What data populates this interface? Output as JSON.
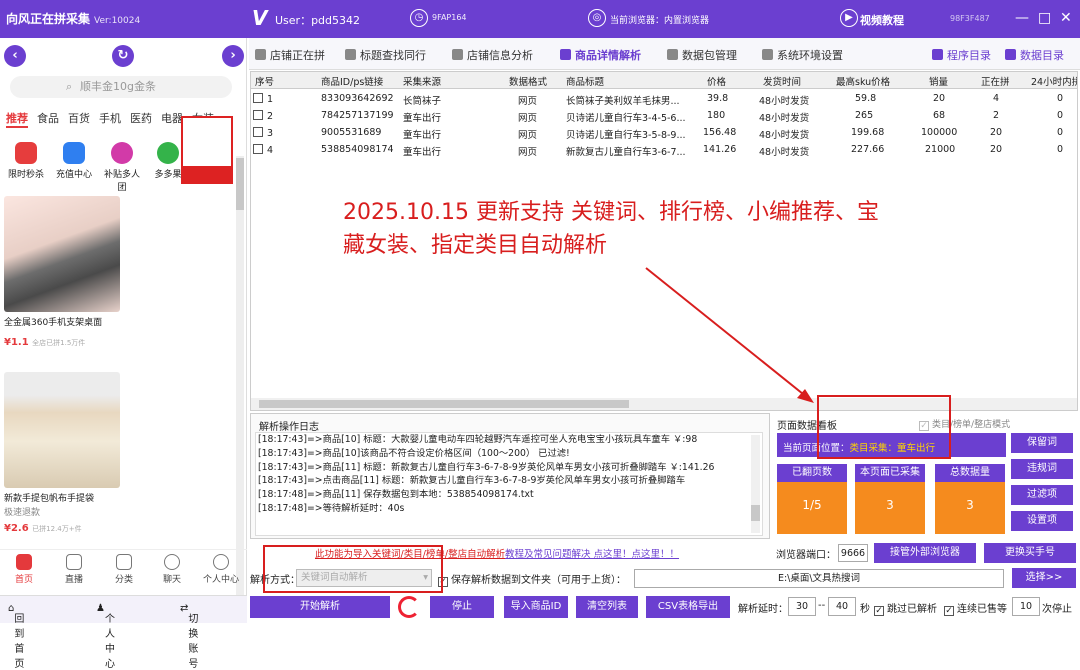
{
  "topbar": {
    "app_title": "向风正在拼采集",
    "version": "Ver:10024",
    "user": "User：pdd5342",
    "device": "9FAP164",
    "browser": "当前浏览器：内置浏览器",
    "tutorial": "视频教程",
    "code": "98F3F487",
    "min": "—",
    "max": "□",
    "close": "✕"
  },
  "left": {
    "back": "‹",
    "refresh": "↻",
    "forward": "›",
    "search_placeholder": "顺丰金10g金条",
    "cats": [
      "推荐",
      "食品",
      "百货",
      "手机",
      "医药",
      "电器",
      "女装"
    ],
    "shortcuts": [
      "限时秒杀",
      "充值中心",
      "补贴多人团",
      "多多果"
    ],
    "products": [
      {
        "title": "全金属360手机支架桌面",
        "price": "¥1.1",
        "sold": "全店已拼1.5万件"
      },
      {
        "title": "新款手提包帆布手提袋",
        "subtitle": "极速退款",
        "price": "¥2.6",
        "sold": "已拼12.4万+件"
      }
    ],
    "bottom_nav": [
      "首页",
      "直播",
      "分类",
      "聊天",
      "个人中心"
    ],
    "footer": {
      "home": "回到首页",
      "personal": "个人中心",
      "switch": "切换账号"
    }
  },
  "tabs": {
    "shops": "店铺正在拼",
    "keyword": "标题查找同行",
    "shop_analysis": "店铺信息分析",
    "detail": "商品详情解析",
    "packages": "数据包管理",
    "env": "系统环境设置",
    "prog_dir": "程序目录",
    "data_dir": "数据目录"
  },
  "table": {
    "headers": [
      "序号",
      "商品ID/ps链接",
      "采集来源",
      "数据格式",
      "商品标题",
      "价格",
      "发货时间",
      "最高sku价格",
      "销量",
      "正在拼",
      "24小时内拼"
    ],
    "rows": [
      [
        "1",
        "833093642692",
        "长筒袜子",
        "网页",
        "长筒袜子美利奴羊毛抹男...",
        "39.8",
        "48小时发货",
        "59.8",
        "20",
        "4",
        "0"
      ],
      [
        "2",
        "784257137199",
        "童车出行",
        "网页",
        "贝诗诺儿童自行车3-4-5-6...",
        "180",
        "48小时发货",
        "265",
        "68",
        "2",
        "0"
      ],
      [
        "3",
        "9005531689",
        "童车出行",
        "网页",
        "贝诗诺儿童自行车3-5-8-9...",
        "156.48",
        "48小时发货",
        "199.68",
        "100000",
        "20",
        "0"
      ],
      [
        "4",
        "538854098174",
        "童车出行",
        "网页",
        "新款复古儿童自行车3-6-7...",
        "141.26",
        "48小时发货",
        "227.66",
        "21000",
        "20",
        "0"
      ]
    ]
  },
  "annotation": {
    "line1": "2025.10.15 更新支持 关键词、排行榜、小编推荐、宝",
    "line2": "藏女装、指定类目自动解析"
  },
  "log": {
    "title": "解析操作日志",
    "lines": [
      "[18:17:43]=>商品[10] 标题：大款婴儿童电动车四轮越野汽车遥控可坐人充电宝宝小孩玩具车童车 ￥:98",
      "[18:17:43]=>商品[10]该商品不符合设定价格区间（100～200） 已过滤!",
      "[18:17:43]=>商品[11] 标题：新款复古儿童自行车3-6-7-8-9岁英伦风单车男女小孩可折叠脚踏车 ￥:141.26",
      "[18:17:43]=>点击商品[11] 标题：新款复古儿童自行车3-6-7-8-9岁英伦风单车男女小孩可折叠脚踏车",
      "[18:17:48]=>商品[11] 保存数据包到本地：538854098174.txt",
      "[18:17:48]=>等待解析延时：40s"
    ]
  },
  "panel": {
    "title": "页面数据看板",
    "mode": "类目/榜单/整店模式",
    "current_label": "当前页面位置：",
    "current_value": "类目采集：童车出行",
    "stats": [
      {
        "label": "已翻页数",
        "value": "1/5"
      },
      {
        "label": "本页面已采集",
        "value": "3"
      },
      {
        "label": "总数据量",
        "value": "3"
      }
    ],
    "buttons": [
      "保留词",
      "违规词",
      "过滤项",
      "设置项"
    ]
  },
  "bar2": {
    "link": "此功能为导入关键词/类目/榜单/整店自动解析",
    "help": "教程及常见问题解决 点这里！点这里！！",
    "port_label": "浏览器端口：",
    "port": "9666",
    "connect": "接管外部浏览器",
    "switch_buyer": "更换买手号"
  },
  "bar3": {
    "mode_label": "解析方式：",
    "mode_value": "关键词自动解析",
    "save_label": "保存解析数据到文件夹（可用于上货）：",
    "path": "E:\\桌面\\文具热搜词",
    "choose": "选择>>"
  },
  "bar4": {
    "start": "开始解析",
    "stop": "停止",
    "import": "导入商品ID",
    "clear": "清空列表",
    "export": "CSV表格导出",
    "delay_label": "解析延时：",
    "delay_min": "30",
    "delay_sep": "--",
    "delay_max": "40",
    "delay_unit": "秒",
    "skip": "跳过已解析",
    "cont": "连续已售等",
    "cont_val": "10",
    "cont_unit": "次停止"
  }
}
